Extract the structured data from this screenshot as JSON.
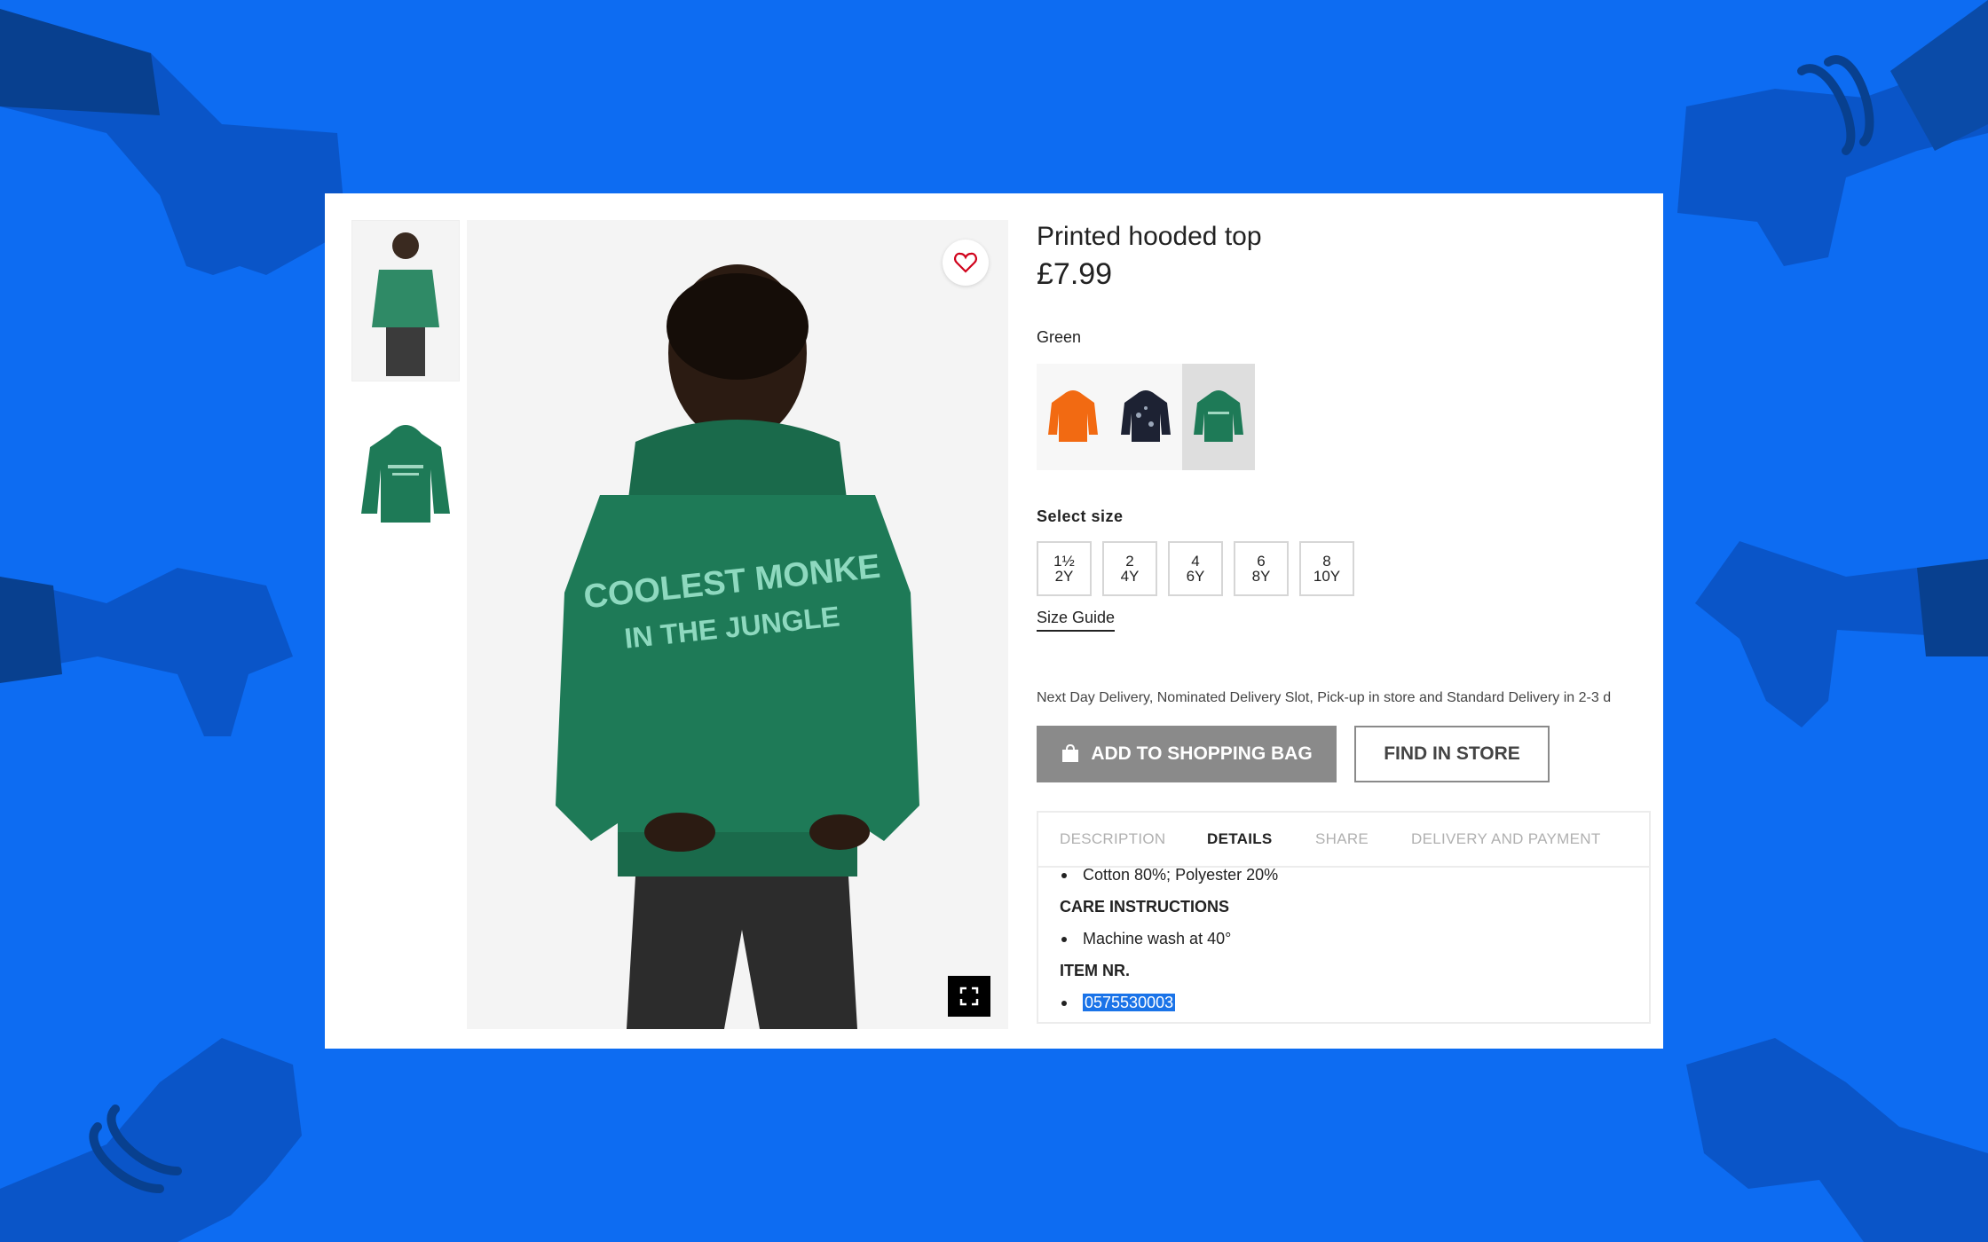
{
  "product": {
    "title": "Printed hooded top",
    "price": "£7.99",
    "color_selected": "Green",
    "swatches": [
      {
        "name": "orange-hoodie",
        "color": "#f26a12"
      },
      {
        "name": "navy-printed-hoodie",
        "color": "#1d2233"
      },
      {
        "name": "green-hoodie",
        "color": "#1e7a57"
      }
    ],
    "select_size_label": "Select size",
    "sizes": [
      {
        "top": "1½",
        "bottom": "2Y"
      },
      {
        "top": "2",
        "bottom": "4Y"
      },
      {
        "top": "4",
        "bottom": "6Y"
      },
      {
        "top": "6",
        "bottom": "8Y"
      },
      {
        "top": "8",
        "bottom": "10Y"
      }
    ],
    "size_guide": "Size Guide",
    "delivery_text": "Next Day Delivery, Nominated Delivery Slot, Pick-up in store and Standard Delivery in 2-3 d",
    "add_to_bag": "ADD TO SHOPPING BAG",
    "find_in_store": "FIND IN STORE"
  },
  "tabs": [
    "DESCRIPTION",
    "DETAILS",
    "SHARE",
    "DELIVERY AND PAYMENT"
  ],
  "active_tab": "DETAILS",
  "details": {
    "composition": "Cotton 80%; Polyester 20%",
    "care_heading": "CARE INSTRUCTIONS",
    "care_item": "Machine wash at 40°",
    "item_heading": "ITEM NR.",
    "item_number": "0575530003"
  },
  "hoodie_print": {
    "line1": "COOLEST MONKE",
    "line2": "IN THE JUNGLE"
  },
  "colors": {
    "background_blue": "#0d6cf2",
    "hand_dark": "#0a4ba8",
    "hoodie_green": "#1e7a57",
    "button_grey": "#8a8a8a",
    "heart_red": "#d0021b"
  },
  "icons": [
    "heart-icon",
    "expand-icon",
    "shopping-bag-icon",
    "thumbs-down-icon"
  ]
}
